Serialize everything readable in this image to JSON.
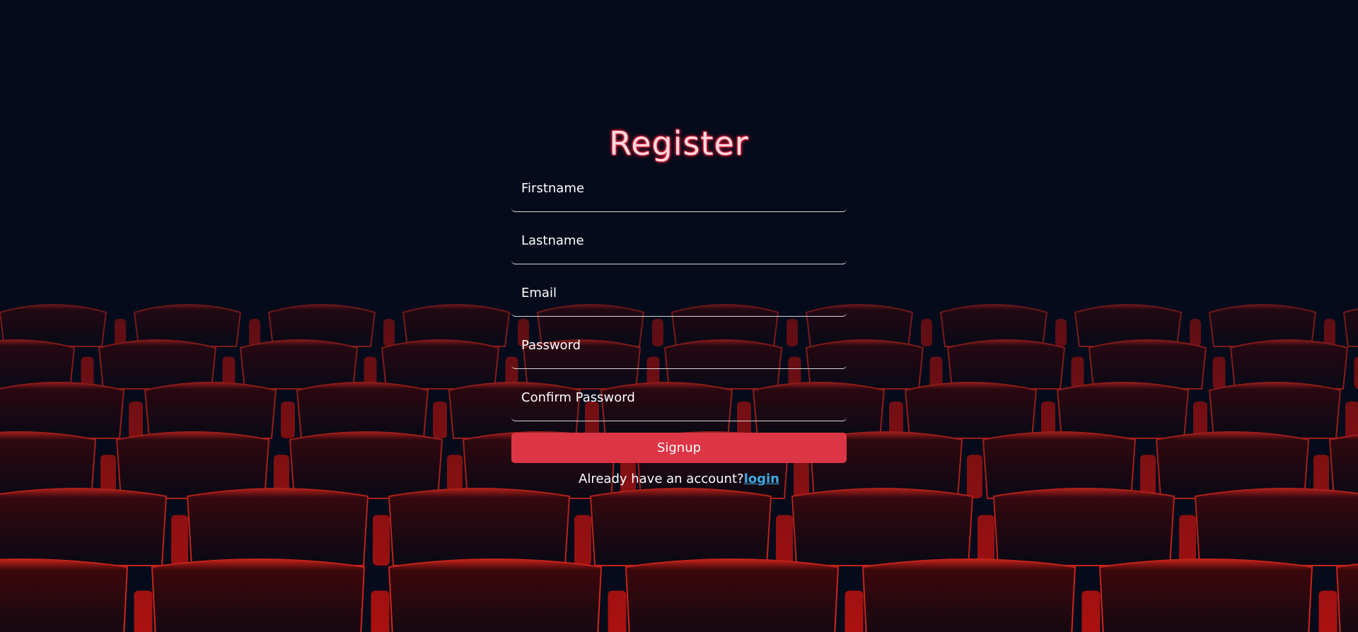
{
  "form": {
    "title": "Register",
    "fields": [
      {
        "placeholder": "Firstname",
        "value": ""
      },
      {
        "placeholder": "Lastname",
        "value": ""
      },
      {
        "placeholder": "Email",
        "value": ""
      },
      {
        "placeholder": "Password",
        "value": ""
      },
      {
        "placeholder": "Confirm Password",
        "value": ""
      }
    ],
    "submit_label": "Signup",
    "already_text": "Already have an account?",
    "login_link": "login"
  },
  "colors": {
    "background": "#050b1a",
    "seat_red": "#e8140f",
    "button": "#dc3545",
    "link": "#3fa9e0"
  }
}
